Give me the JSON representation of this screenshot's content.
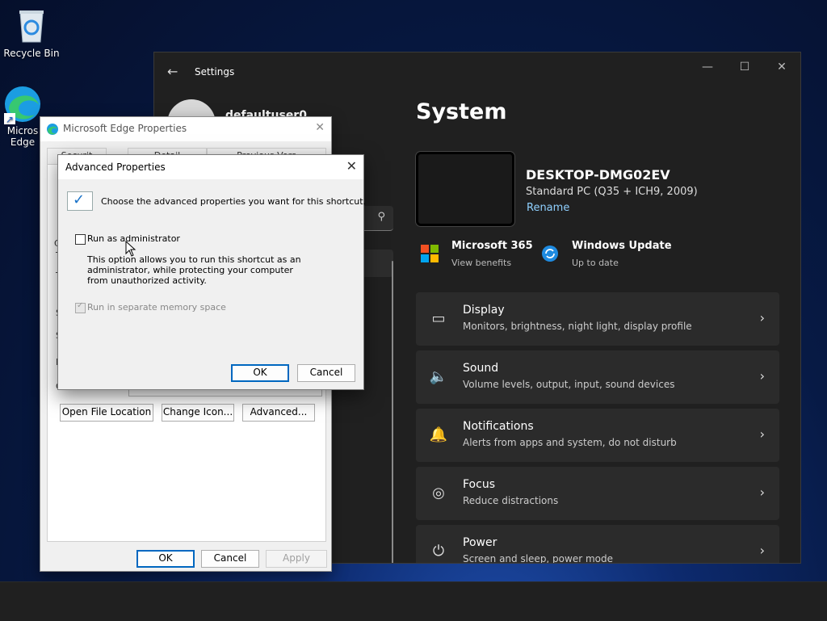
{
  "desktop": {
    "recycle_bin_label": "Recycle Bin",
    "edge_label_line1": "Micros",
    "edge_label_line2": "Edge"
  },
  "settings": {
    "window_title": "Settings",
    "back_glyph": "←",
    "minimize_glyph": "—",
    "maximize_glyph": "☐",
    "close_glyph": "✕",
    "user_name": "defaultuser0",
    "search_icon": "⚲",
    "page_title": "System",
    "device": {
      "name": "DESKTOP-DMG02EV",
      "model": "Standard PC (Q35 + ICH9, 2009)",
      "rename_label": "Rename"
    },
    "quick_tiles": [
      {
        "title": "Microsoft 365",
        "subtitle": "View benefits",
        "icon": "microsoft-logo"
      },
      {
        "title": "Windows Update",
        "subtitle": "Up to date",
        "icon": "update-icon"
      }
    ],
    "cards": [
      {
        "title": "Display",
        "subtitle": "Monitors, brightness, night light, display profile",
        "icon": "display-icon",
        "glyph": "▭"
      },
      {
        "title": "Sound",
        "subtitle": "Volume levels, output, input, sound devices",
        "icon": "speaker-icon",
        "glyph": "🔈"
      },
      {
        "title": "Notifications",
        "subtitle": "Alerts from apps and system, do not disturb",
        "icon": "bell-icon",
        "glyph": "🔔"
      },
      {
        "title": "Focus",
        "subtitle": "Reduce distractions",
        "icon": "focus-icon",
        "glyph": "◎"
      },
      {
        "title": "Power",
        "subtitle": "Screen and sleep, power mode",
        "icon": "power-icon",
        "glyph": "⏻"
      }
    ],
    "chevron": "›"
  },
  "edge_properties": {
    "title": "Microsoft Edge Properties",
    "close_glyph": "✕",
    "tabs": [
      "Securit",
      "Detail",
      "Previous Vers"
    ],
    "side_fragments": [
      "C",
      "T",
      "T",
      "S",
      "S",
      "R",
      "C",
      "C"
    ],
    "buttons": {
      "open_file_location": "Open File Location",
      "change_icon": "Change Icon...",
      "advanced": "Advanced...",
      "ok": "OK",
      "cancel": "Cancel",
      "apply": "Apply"
    }
  },
  "advanced_properties": {
    "title": "Advanced Properties",
    "close_glyph": "✕",
    "intro": "Choose the advanced properties you want for this shortcut.",
    "run_as_admin_label": "Run as administrator",
    "run_as_admin_checked": false,
    "description": "This option allows you to run this shortcut as an administrator, while protecting your computer from unauthorized activity.",
    "separate_memory_label": "Run in separate memory space",
    "separate_memory_checked": true,
    "ok_label": "OK",
    "cancel_label": "Cancel"
  }
}
